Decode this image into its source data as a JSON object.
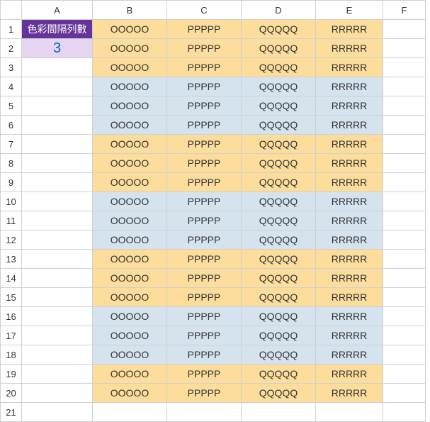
{
  "columns": [
    "A",
    "B",
    "C",
    "D",
    "E",
    "F"
  ],
  "row_headers": [
    "1",
    "2",
    "3",
    "4",
    "5",
    "6",
    "7",
    "8",
    "9",
    "10",
    "11",
    "12",
    "13",
    "14",
    "15",
    "16",
    "17",
    "18",
    "19",
    "20",
    "21"
  ],
  "a1_label": "色彩間隔列數",
  "a2_value": "3",
  "cell_text": {
    "b": "OOOOO",
    "c": "PPPPP",
    "d": "QQQQQ",
    "e": "RRRRR"
  },
  "bands": [
    "o",
    "o",
    "o",
    "b",
    "b",
    "b",
    "o",
    "o",
    "o",
    "b",
    "b",
    "b",
    "o",
    "o",
    "o",
    "b",
    "b",
    "b",
    "o",
    "o",
    "w"
  ]
}
